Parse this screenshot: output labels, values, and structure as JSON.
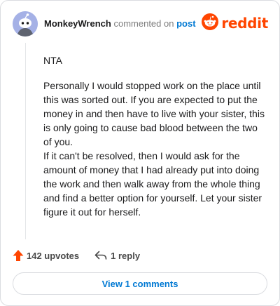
{
  "header": {
    "username": "MonkeyWrench",
    "action_text": "commented on",
    "post_link": "post",
    "brand": "reddit"
  },
  "comment": {
    "paragraphs": [
      "NTA",
      "Personally I would stopped work on the place until this was sorted out. If you are expected to put the money in and then have to live with your sister, this is only going to cause bad blood between the two of you.",
      "If it can't be resolved, then I would ask for the amount of money that I had already put into doing the work and then walk away from the whole thing and find a better option for yourself. Let your sister figure it out for herself."
    ]
  },
  "actions": {
    "upvotes": "142 upvotes",
    "replies": "1 reply"
  },
  "view_comments": "View 1 comments",
  "colors": {
    "brand": "#ff4500",
    "link": "#0079d3",
    "upvote": "#ff4500",
    "avatar_bg": "#a5b1e6"
  },
  "icons": {
    "avatar": "snoo-avatar-icon",
    "brand": "reddit-logo-icon",
    "upvote": "upvote-arrow-icon",
    "reply": "reply-arrow-icon"
  }
}
